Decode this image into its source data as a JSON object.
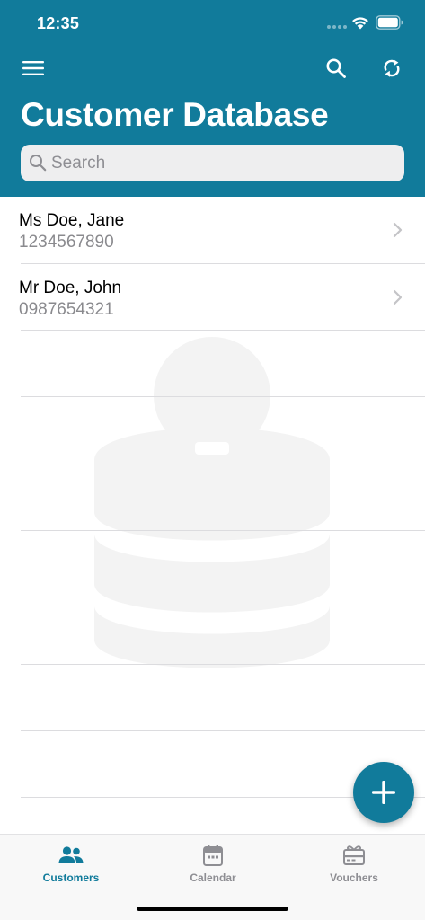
{
  "status_bar": {
    "time": "12:35"
  },
  "header": {
    "title": "Customer Database"
  },
  "search": {
    "placeholder": "Search",
    "value": ""
  },
  "customers": [
    {
      "name": "Ms Doe, Jane",
      "phone": "1234567890"
    },
    {
      "name": "Mr Doe, John",
      "phone": "0987654321"
    }
  ],
  "tabs": [
    {
      "label": "Customers",
      "icon": "customers-icon",
      "active": true
    },
    {
      "label": "Calendar",
      "icon": "calendar-icon",
      "active": false
    },
    {
      "label": "Vouchers",
      "icon": "vouchers-icon",
      "active": false
    }
  ],
  "colors": {
    "accent": "#117b9b",
    "inactive_tab": "#8e8e93",
    "background": "#ffffff"
  }
}
